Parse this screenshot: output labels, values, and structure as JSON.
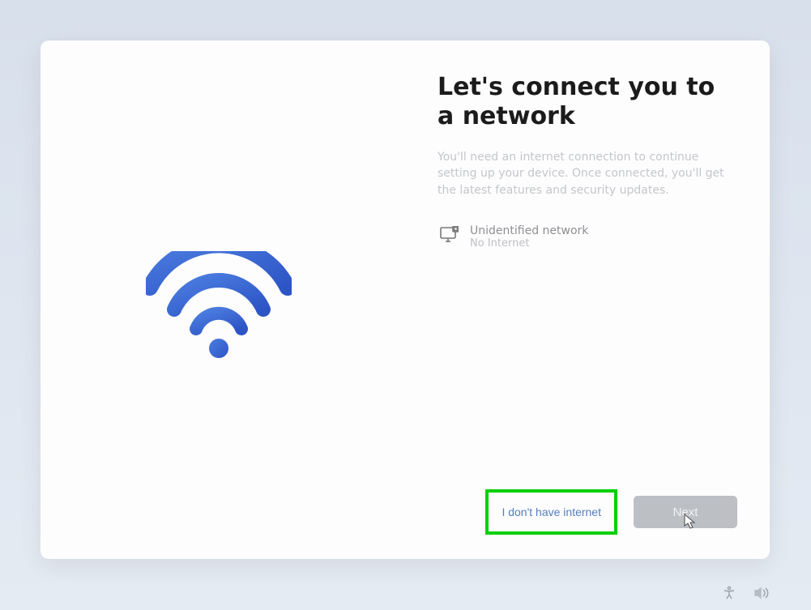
{
  "title": "Let's connect you to a network",
  "subtitle": "You'll need an internet connection to continue setting up your device. Once connected, you'll get the latest features and security updates.",
  "network": {
    "name": "Unidentified network",
    "status": "No Internet"
  },
  "buttons": {
    "no_internet": "I don't have internet",
    "next": "Next"
  }
}
